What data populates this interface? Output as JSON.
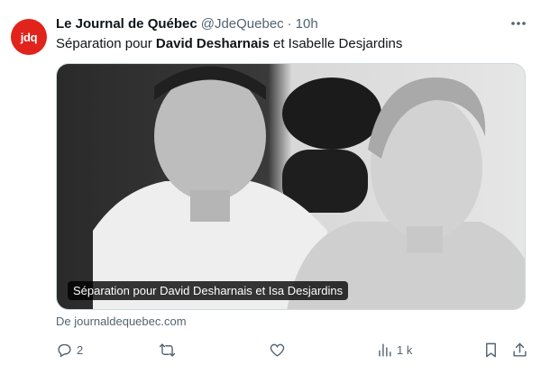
{
  "avatar": {
    "text": "jdq",
    "color": "#e0241b"
  },
  "post": {
    "author_name": "Le Journal de Québec",
    "handle": "@JdeQuebec",
    "separator": "·",
    "time": "10h",
    "text_before": "Séparation pour ",
    "text_bold": "David Desharnais",
    "text_after": " et Isabelle Desjardins"
  },
  "card": {
    "caption": "Séparation pour David Desharnais et Isa Desjardins",
    "source": "De journaldequebec.com"
  },
  "actions": {
    "reply_icon": "reply-icon",
    "reply_count": "2",
    "retweet_icon": "retweet-icon",
    "retweet_count": "",
    "like_icon": "heart-icon",
    "like_count": "",
    "views_icon": "views-bar-chart-icon",
    "views_count": "1 k",
    "bookmark_icon": "bookmark-icon",
    "share_icon": "share-icon"
  }
}
